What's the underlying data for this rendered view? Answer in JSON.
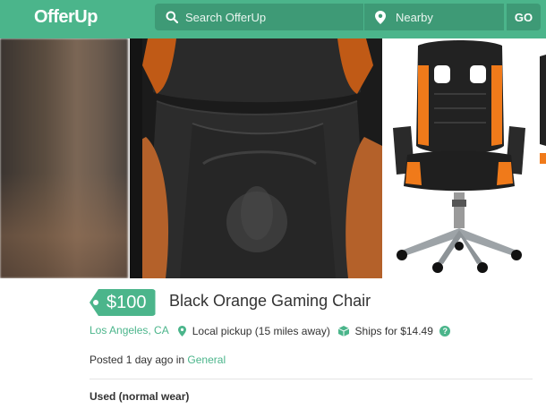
{
  "header": {
    "logo": "OfferUp",
    "search_placeholder": "Search OfferUp",
    "location_placeholder": "Nearby",
    "go_label": "GO"
  },
  "listing": {
    "price": "$100",
    "title": "Black Orange Gaming Chair",
    "location": "Los Angeles, CA",
    "pickup": "Local pickup (15 miles away)",
    "shipping": "Ships for $14.49",
    "help_label": "?",
    "posted_prefix": "Posted 1 day ago in",
    "category": "General",
    "condition": "Used (normal wear)"
  },
  "colors": {
    "brand": "#4bb58b",
    "brand_dark": "#3e9a76",
    "chair_accent": "#f07a1a"
  },
  "icons": [
    "search-icon",
    "map-pin-icon",
    "box-icon",
    "help-icon"
  ]
}
